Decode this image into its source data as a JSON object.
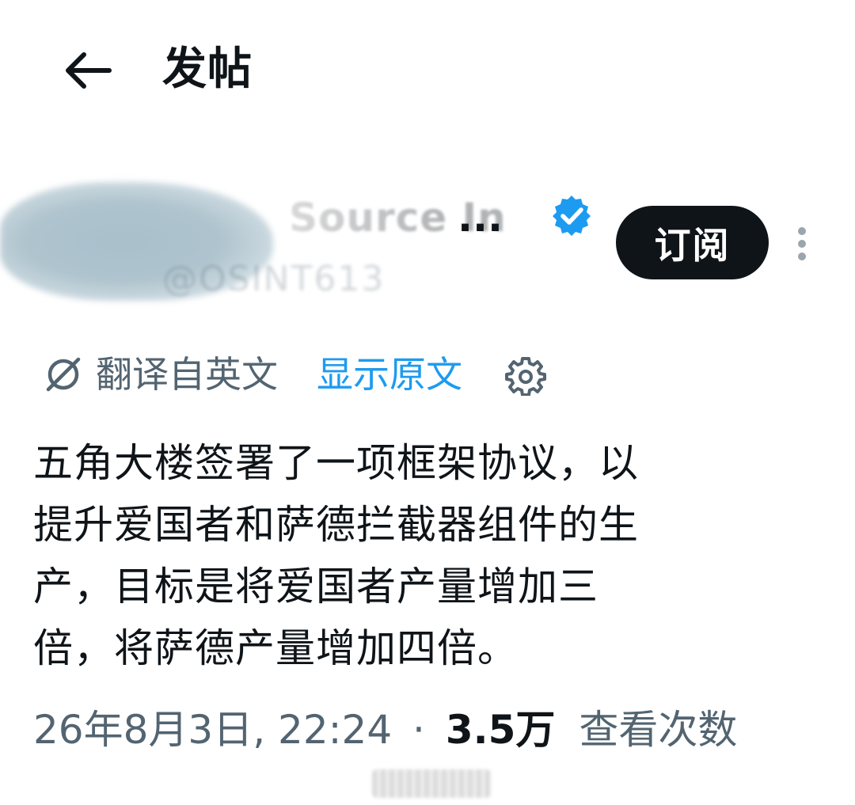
{
  "header": {
    "back_icon": "arrow-left-icon",
    "title": "发帖"
  },
  "author": {
    "display_name_visible": "Source In",
    "display_name_ellipsis": "...",
    "handle": "@OSINT613",
    "verified_icon": "verified-badge-icon",
    "verified_color": "#1d9bf0",
    "subscribe_label": "订阅",
    "more_icon": "more-vertical-icon"
  },
  "translation": {
    "icon": "translate-slash-icon",
    "label": "翻译自英文",
    "show_original": "显示原文",
    "settings_icon": "gear-icon"
  },
  "tweet": {
    "text_lines": [
      "五角大楼签署了一项框架协议，以",
      "提升爱国者和萨德拦截器组件的生",
      "产，目标是将爱国者产量增加三",
      "倍，将萨德产量增加四倍。"
    ]
  },
  "meta": {
    "timestamp": "26年8月3日, 22:24",
    "separator": "·",
    "views_count": "3.5万",
    "views_label": "查看次数"
  },
  "colors": {
    "text_primary": "#0f1419",
    "text_secondary": "#536471",
    "link": "#1d9bf0",
    "button_bg": "#0f1419"
  }
}
